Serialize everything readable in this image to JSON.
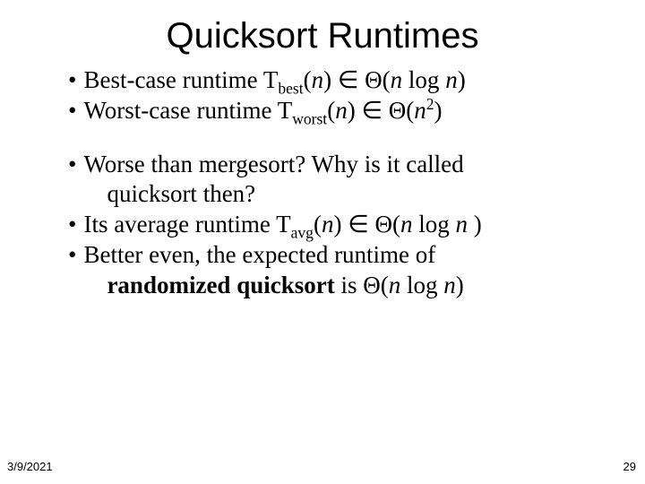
{
  "title": "Quicksort Runtimes",
  "glyph": {
    "in": "∈",
    "theta": "Θ"
  },
  "bullets1": {
    "b1": {
      "pre": "Best-case runtime T",
      "sub": "best",
      "open": "(",
      "n1": "n",
      "close": ") ",
      "open2": "(",
      "n2": "n",
      "mid": " log ",
      "n3": "n",
      "close2": ")"
    },
    "b2": {
      "pre": "Worst-case runtime T",
      "sub": "worst",
      "open": "(",
      "n1": "n",
      "close": ") ",
      "open2": "(",
      "n2": "n",
      "sup": "2",
      "close2": ")"
    }
  },
  "bullets2": {
    "b3": {
      "line1": "Worse than mergesort? Why is it called",
      "line2": "quicksort then?"
    },
    "b4": {
      "pre": "Its average runtime T",
      "sub": "avg",
      "open": "(",
      "n1": "n",
      "close": ") ",
      "open2": "(",
      "n2": "n",
      "mid": " log ",
      "n3": "n ",
      "close2": ")"
    },
    "b5": {
      "line1a": "Better even, the expected runtime of",
      "line2strong": "randomized quicksort",
      "line2rest": " is ",
      "open2": "(",
      "n2": "n",
      "mid": " log ",
      "n3": "n",
      "close2": ")"
    }
  },
  "footer": {
    "date": "3/9/2021",
    "page": "29"
  }
}
